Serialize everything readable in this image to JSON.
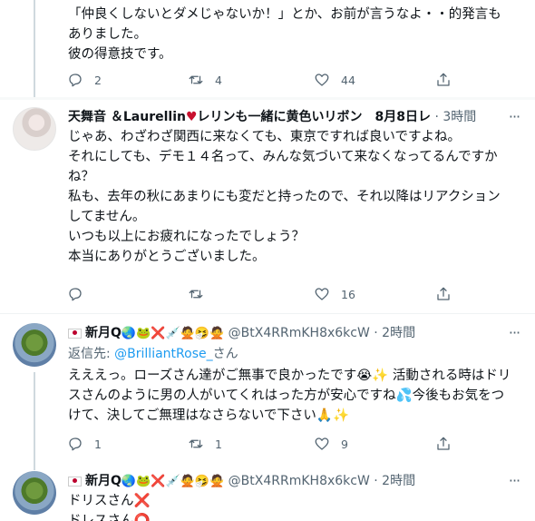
{
  "tweets": [
    {
      "lines": [
        "「仲良くしないとダメじゃないか！」とか、お前が言うなよ・・的発言も",
        "ありました。",
        "彼の得意技です。"
      ],
      "actions": {
        "reply": "2",
        "retweet": "4",
        "like": "44",
        "share": ""
      }
    },
    {
      "display_name": "天舞音 ＆Laurellin",
      "name_suffix": "レリンも一緒に黄色いリボン　8月8日レ",
      "heart": "♥",
      "separator": "·",
      "time": "3時間",
      "lines": [
        "じゃあ、わざわざ関西に来なくても、東京ですれば良いですよね。",
        "それにしても、デモ１４名って、みんな気づいて来なくなってるんですか",
        "ね？",
        "私も、去年の秋にあまりにも変だと持ったので、それ以降はリアクション",
        "してません。",
        "",
        "いつも以上にお疲れになったでしょう？",
        "本当にありがとうございました。"
      ],
      "actions": {
        "reply": "",
        "retweet": "",
        "like": "16",
        "share": ""
      }
    },
    {
      "display_name": "新月Q",
      "name_emoji": "🌏🐸❌💉🙅🤧🙅",
      "handle": "@BtX4RRmKH8x6kcW",
      "separator": "·",
      "time": "2時間",
      "reply_prefix": "返信先: ",
      "reply_mention": "@BrilliantRose_",
      "reply_suffix": "さん",
      "lines": [
        "えええっ。ローズさん達がご無事で良かったです😭✨ 活動される時はドリ",
        "スさんのように男の人がいてくれはった方が安心ですね💦今後もお気をつ",
        "けて、決してご無理はなさらないで下さい🙏✨"
      ],
      "actions": {
        "reply": "1",
        "retweet": "1",
        "like": "9",
        "share": ""
      }
    },
    {
      "display_name": "新月Q",
      "name_emoji": "🌏🐸❌💉🙅🤧🙅",
      "handle": "@BtX4RRmKH8x6kcW",
      "separator": "·",
      "time": "2時間",
      "line1_text": "ドリスさん",
      "line1_mark": "❌",
      "line2_text": "ドレスさん",
      "line2_mark": "⭕"
    }
  ],
  "icons": [
    "more-icon",
    "reply-icon",
    "retweet-icon",
    "like-icon",
    "share-icon",
    "flag-jp-icon"
  ],
  "colors": {
    "link": "#1d9bf0",
    "muted": "#536471",
    "heart": "#c8102e",
    "divider": "#eff3f4"
  }
}
